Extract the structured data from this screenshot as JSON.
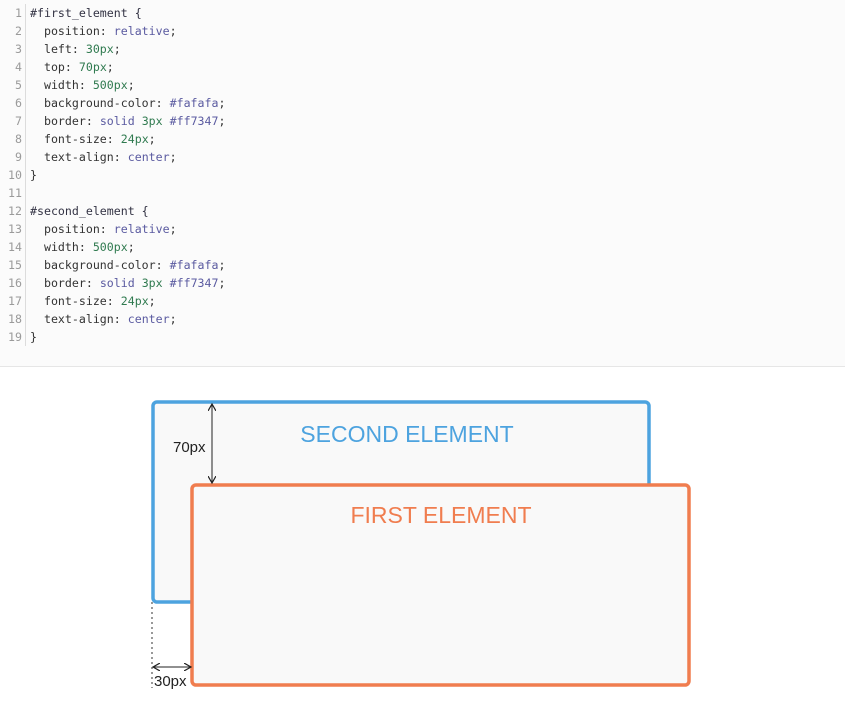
{
  "code": {
    "lines": [
      {
        "n": "1",
        "parts": [
          {
            "t": "#first_element {",
            "c": "sel"
          }
        ]
      },
      {
        "n": "2",
        "parts": [
          {
            "t": "  position: ",
            "c": "prop"
          },
          {
            "t": "relative",
            "c": "kw"
          },
          {
            "t": ";",
            "c": "plain"
          }
        ]
      },
      {
        "n": "3",
        "parts": [
          {
            "t": "  left: ",
            "c": "prop"
          },
          {
            "t": "30px",
            "c": "num"
          },
          {
            "t": ";",
            "c": "plain"
          }
        ]
      },
      {
        "n": "4",
        "parts": [
          {
            "t": "  top: ",
            "c": "prop"
          },
          {
            "t": "70px",
            "c": "num"
          },
          {
            "t": ";",
            "c": "plain"
          }
        ]
      },
      {
        "n": "5",
        "parts": [
          {
            "t": "  width: ",
            "c": "prop"
          },
          {
            "t": "500px",
            "c": "num"
          },
          {
            "t": ";",
            "c": "plain"
          }
        ]
      },
      {
        "n": "6",
        "parts": [
          {
            "t": "  background-color: ",
            "c": "prop"
          },
          {
            "t": "#fafafa",
            "c": "kw"
          },
          {
            "t": ";",
            "c": "plain"
          }
        ]
      },
      {
        "n": "7",
        "parts": [
          {
            "t": "  border: ",
            "c": "prop"
          },
          {
            "t": "solid ",
            "c": "kw"
          },
          {
            "t": "3px ",
            "c": "num"
          },
          {
            "t": "#ff7347",
            "c": "kw"
          },
          {
            "t": ";",
            "c": "plain"
          }
        ]
      },
      {
        "n": "8",
        "parts": [
          {
            "t": "  font-size: ",
            "c": "prop"
          },
          {
            "t": "24px",
            "c": "num"
          },
          {
            "t": ";",
            "c": "plain"
          }
        ]
      },
      {
        "n": "9",
        "parts": [
          {
            "t": "  text-align: ",
            "c": "prop"
          },
          {
            "t": "center",
            "c": "kw"
          },
          {
            "t": ";",
            "c": "plain"
          }
        ]
      },
      {
        "n": "10",
        "parts": [
          {
            "t": "}",
            "c": "plain"
          }
        ]
      },
      {
        "n": "11",
        "parts": []
      },
      {
        "n": "12",
        "parts": [
          {
            "t": "#second_element {",
            "c": "sel"
          }
        ]
      },
      {
        "n": "13",
        "parts": [
          {
            "t": "  position: ",
            "c": "prop"
          },
          {
            "t": "relative",
            "c": "kw"
          },
          {
            "t": ";",
            "c": "plain"
          }
        ]
      },
      {
        "n": "14",
        "parts": [
          {
            "t": "  width: ",
            "c": "prop"
          },
          {
            "t": "500px",
            "c": "num"
          },
          {
            "t": ";",
            "c": "plain"
          }
        ]
      },
      {
        "n": "15",
        "parts": [
          {
            "t": "  background-color: ",
            "c": "prop"
          },
          {
            "t": "#fafafa",
            "c": "kw"
          },
          {
            "t": ";",
            "c": "plain"
          }
        ]
      },
      {
        "n": "16",
        "parts": [
          {
            "t": "  border: ",
            "c": "prop"
          },
          {
            "t": "solid ",
            "c": "kw"
          },
          {
            "t": "3px ",
            "c": "num"
          },
          {
            "t": "#ff7347",
            "c": "kw"
          },
          {
            "t": ";",
            "c": "plain"
          }
        ]
      },
      {
        "n": "17",
        "parts": [
          {
            "t": "  font-size: ",
            "c": "prop"
          },
          {
            "t": "24px",
            "c": "num"
          },
          {
            "t": ";",
            "c": "plain"
          }
        ]
      },
      {
        "n": "18",
        "parts": [
          {
            "t": "  text-align: ",
            "c": "prop"
          },
          {
            "t": "center",
            "c": "kw"
          },
          {
            "t": ";",
            "c": "plain"
          }
        ]
      },
      {
        "n": "19",
        "parts": [
          {
            "t": "}",
            "c": "plain"
          }
        ]
      }
    ]
  },
  "diagram": {
    "second_label": "SECOND ELEMENT",
    "first_label": "FIRST ELEMENT",
    "top_offset_label": "70px",
    "left_offset_label": "30px",
    "colors": {
      "second_border": "#4da3df",
      "first_border": "#f07d4f",
      "box_fill": "#f9f9f9",
      "dimension": "#222222"
    }
  }
}
